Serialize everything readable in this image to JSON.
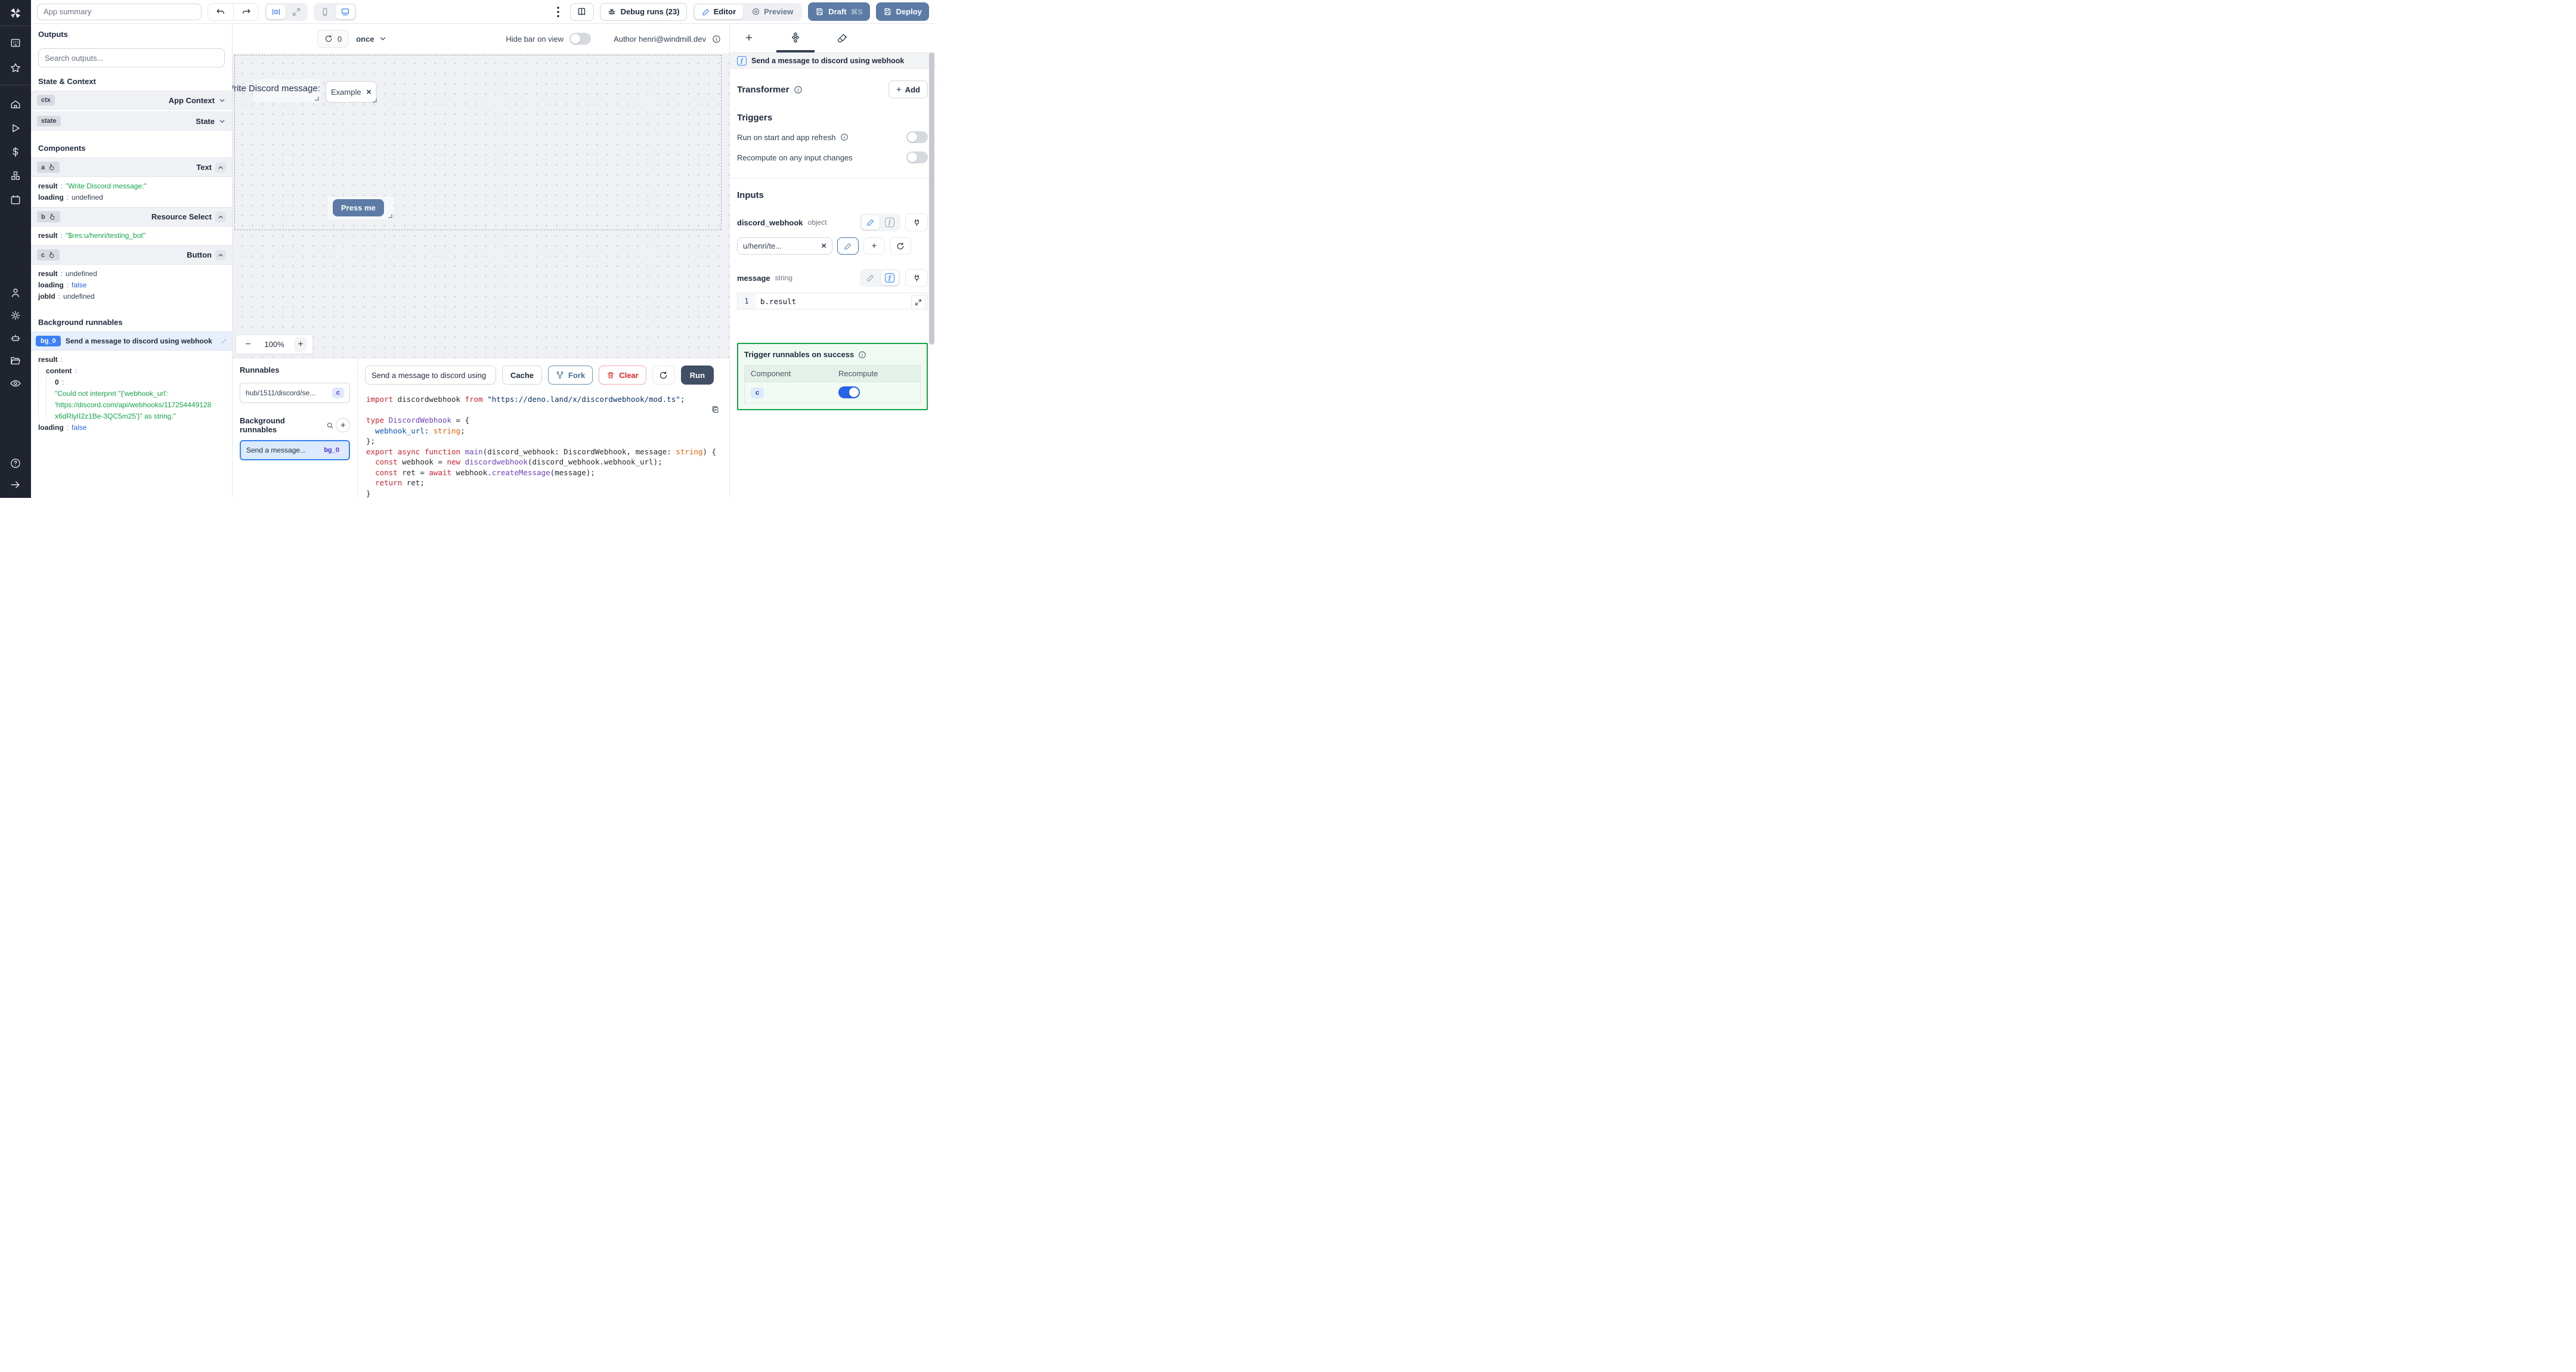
{
  "topbar": {
    "app_summary_placeholder": "App summary",
    "debug_runs_label": "Debug runs (23)",
    "editor_label": "Editor",
    "preview_label": "Preview",
    "draft_label": "Draft",
    "draft_shortcut": "⌘S",
    "deploy_label": "Deploy"
  },
  "icons": {
    "close": "×",
    "plus": "+",
    "minus": "−",
    "refresh_count": "0"
  },
  "outputs_panel": {
    "title": "Outputs",
    "search_placeholder": "Search outputs...",
    "state_context_title": "State & Context",
    "ctx_badge": "ctx",
    "ctx_label": "App Context",
    "state_badge": "state",
    "state_label": "State",
    "components_title": "Components",
    "components": [
      {
        "id": "a",
        "type": "Text",
        "rows": [
          {
            "key": "result",
            "value": "\"Write Discord message:\""
          },
          {
            "key": "loading",
            "value": "undefined"
          }
        ]
      },
      {
        "id": "b",
        "type": "Resource Select",
        "rows": [
          {
            "key": "result",
            "value": "\"$res:u/henri/testing_bot\""
          }
        ]
      },
      {
        "id": "c",
        "type": "Button",
        "rows": [
          {
            "key": "result",
            "value": "undefined"
          },
          {
            "key": "loading",
            "value": "false"
          },
          {
            "key": "jobId",
            "value": "undefined"
          }
        ]
      }
    ],
    "background_title": "Background runnables",
    "bg0_badge": "bg_0",
    "bg0_label": "Send a message to discord using webhook",
    "bg0_result_key": "result",
    "bg0_content_key": "content",
    "bg0_index_key": "0",
    "bg0_error_lines": [
      "\"Could not interpret \"{'webhook_url':",
      "'https://discord.com/api/webhooks/117254449128",
      "x6dRlyII2z1Be-3QC5m25'}\" as string.\""
    ],
    "bg0_loading_key": "loading",
    "bg0_loading_value": "false"
  },
  "canvas": {
    "refresh_count": "0",
    "schedule_value": "once",
    "hide_bar_label": "Hide bar on view",
    "author_label": "Author henri@windmill.dev",
    "text_component_value": "Write Discord message:",
    "select_component_value": "Example resou...",
    "button_label": "Press me",
    "zoom_level": "100%"
  },
  "runnables_panel": {
    "title": "Runnables",
    "item_label": "hub/1511/discord/se...",
    "item_badge": "c",
    "background_title": "Background runnables",
    "selected_label": "Send a message...",
    "selected_badge": "bg_0"
  },
  "script_panel": {
    "name_value": "Send a message to discord using",
    "cache_label": "Cache",
    "fork_label": "Fork",
    "clear_label": "Clear",
    "run_label": "Run",
    "code_lines": [
      [
        [
          "k",
          "import"
        ],
        [
          "p",
          " discordwebhook "
        ],
        [
          "k",
          "from"
        ],
        [
          "s",
          " \"https://deno.land/x/discordwebhook/mod.ts\""
        ],
        [
          "p",
          ";"
        ]
      ],
      [],
      [
        [
          "k",
          "type"
        ],
        [
          "t",
          " DiscordWebhook"
        ],
        [
          "p",
          " = {"
        ]
      ],
      [
        [
          "b",
          "  webhook_url"
        ],
        [
          "p",
          ": "
        ],
        [
          "o",
          "string"
        ],
        [
          "p",
          ";"
        ]
      ],
      [
        [
          "p",
          "};"
        ]
      ],
      [
        [
          "k",
          "export"
        ],
        [
          "p",
          " "
        ],
        [
          "k",
          "async"
        ],
        [
          "p",
          " "
        ],
        [
          "k",
          "function"
        ],
        [
          "t",
          " main"
        ],
        [
          "p",
          "(discord_webhook: DiscordWebhook, message: "
        ],
        [
          "o",
          "string"
        ],
        [
          "p",
          ") {"
        ]
      ],
      [
        [
          "p",
          "  "
        ],
        [
          "k",
          "const"
        ],
        [
          "p",
          " webhook = "
        ],
        [
          "k",
          "new"
        ],
        [
          "t",
          " discordwebhook"
        ],
        [
          "p",
          "(discord_webhook.webhook_url);"
        ]
      ],
      [
        [
          "p",
          "  "
        ],
        [
          "k",
          "const"
        ],
        [
          "p",
          " ret = "
        ],
        [
          "k",
          "await"
        ],
        [
          "p",
          " webhook."
        ],
        [
          "t",
          "createMessage"
        ],
        [
          "p",
          "(message);"
        ]
      ],
      [
        [
          "p",
          "  "
        ],
        [
          "k",
          "return"
        ],
        [
          "p",
          " ret;"
        ]
      ],
      [
        [
          "p",
          "}"
        ]
      ]
    ]
  },
  "settings_panel": {
    "header_label": "Send a message to discord using webhook",
    "transformer_label": "Transformer",
    "add_label": "Add",
    "triggers_title": "Triggers",
    "trigger_run_on_start": "Run on start and app refresh",
    "trigger_recompute": "Recompute on any input changes",
    "inputs_title": "Inputs",
    "input1_name": "discord_webhook",
    "input1_type": "object",
    "input1_value": "u/henri/te...",
    "input2_name": "message",
    "input2_type": "string",
    "input2_line_number": "1",
    "input2_code": "b.result",
    "success_title": "Trigger runnables on success",
    "success_col_component": "Component",
    "success_col_recompute": "Recompute",
    "success_row_badge": "c"
  }
}
